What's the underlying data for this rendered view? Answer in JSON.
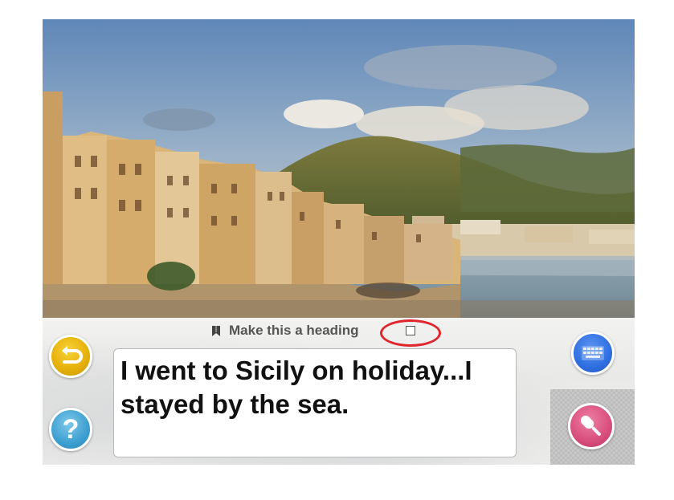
{
  "photo": {
    "icon": "cefalu-seafront-photo"
  },
  "editor": {
    "heading_toggle_label": "Make this a heading",
    "heading_checked": false,
    "caption_text": "I went to Sicily on holiday...I stayed by the sea."
  },
  "buttons": {
    "back_icon": "back-arrow-icon",
    "help_label": "?",
    "keyboard_icon": "keyboard-icon",
    "mic_icon": "microphone-icon"
  },
  "colors": {
    "back_button": "#e6b20b",
    "help_button": "#3d9fd0",
    "keyboard_button": "#2f6fe2",
    "mic_button": "#d84e7c",
    "highlight_ring": "#e0262c"
  }
}
